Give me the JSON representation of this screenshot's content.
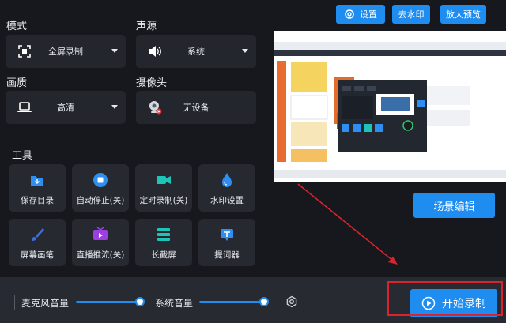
{
  "top_buttons": {
    "settings": "设置",
    "remove_watermark": "去水印",
    "enlarge_preview": "放大预览"
  },
  "mode": {
    "label": "模式",
    "value": "全屏录制"
  },
  "audio_source": {
    "label": "声源",
    "value": "系统"
  },
  "quality": {
    "label": "画质",
    "value": "高清"
  },
  "camera": {
    "label": "摄像头",
    "value": "无设备"
  },
  "tools": {
    "label": "工具",
    "items": [
      {
        "label": "保存目录",
        "icon": "folder-download-icon"
      },
      {
        "label": "自动停止(关)",
        "icon": "stop-circle-icon"
      },
      {
        "label": "定时录制(关)",
        "icon": "video-camera-icon"
      },
      {
        "label": "水印设置",
        "icon": "water-drop-icon"
      },
      {
        "label": "屏幕画笔",
        "icon": "brush-icon"
      },
      {
        "label": "直播推流(关)",
        "icon": "tv-play-icon"
      },
      {
        "label": "长截屏",
        "icon": "layers-icon"
      },
      {
        "label": "提词器",
        "icon": "teleprompter-icon"
      }
    ]
  },
  "scene_edit": "场景编辑",
  "bottom": {
    "mic_volume_label": "麦克风音量",
    "mic_volume": 1.0,
    "system_volume_label": "系统音量",
    "system_volume": 1.0,
    "record_label": "开始录制"
  },
  "colors": {
    "accent": "#1f8cf0",
    "background": "#16181d",
    "panel": "#23262d",
    "annotation_red": "#d9232e"
  }
}
